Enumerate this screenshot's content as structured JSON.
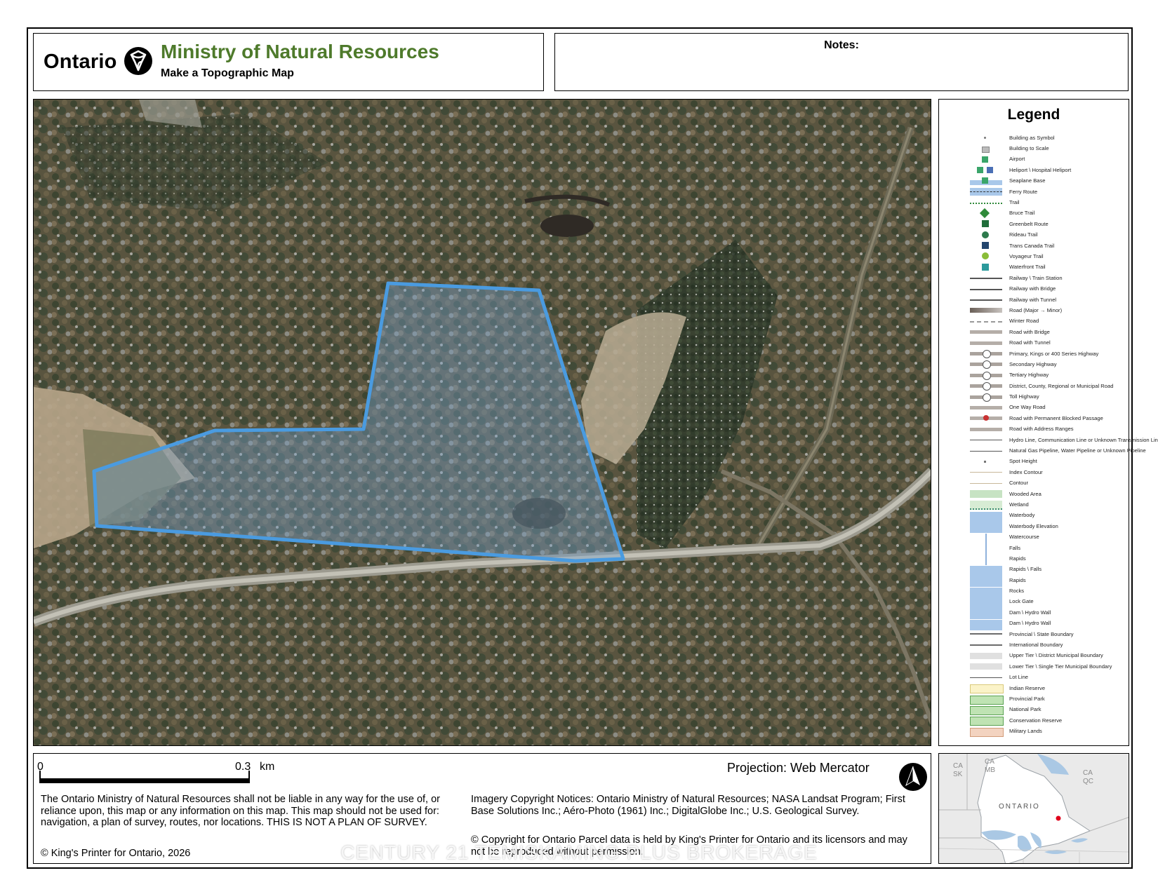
{
  "header": {
    "ontario_wordmark": "Ontario",
    "title": "Ministry of Natural Resources",
    "subtitle": "Make a Topographic Map",
    "notes_label": "Notes:",
    "title_color": "#4e7a2b"
  },
  "map": {
    "imagery": "aerial",
    "parcel_outline_color": "#4a9be0"
  },
  "legend": {
    "title": "Legend",
    "items": [
      {
        "label": "Building as Symbol",
        "symbol": "dot"
      },
      {
        "label": "Building to Scale",
        "symbol": "building"
      },
      {
        "label": "Airport",
        "symbol": "airport-icon"
      },
      {
        "label": "Heliport \\ Hospital Heliport",
        "symbol": "heliport-icon"
      },
      {
        "label": "Seaplane Base",
        "symbol": "seaplane-icon"
      },
      {
        "label": "Ferry Route",
        "symbol": "ferry-line"
      },
      {
        "label": "Trail",
        "symbol": "trail-line"
      },
      {
        "label": "Bruce Trail",
        "symbol": "bruce-trail-icon"
      },
      {
        "label": "Greenbelt Route",
        "symbol": "greenbelt-icon"
      },
      {
        "label": "Rideau Trail",
        "symbol": "rideau-icon"
      },
      {
        "label": "Trans Canada Trail",
        "symbol": "trans-canada-icon"
      },
      {
        "label": "Voyageur Trail",
        "symbol": "voyageur-icon"
      },
      {
        "label": "Waterfront Trail",
        "symbol": "waterfront-icon"
      },
      {
        "label": "Railway \\ Train Station",
        "symbol": "railway"
      },
      {
        "label": "Railway with Bridge",
        "symbol": "railway"
      },
      {
        "label": "Railway with Tunnel",
        "symbol": "railway"
      },
      {
        "label": "Road (Major → Minor)",
        "symbol": "road-taper"
      },
      {
        "label": "Winter Road",
        "symbol": "dashed-road"
      },
      {
        "label": "Road with Bridge",
        "symbol": "road"
      },
      {
        "label": "Road with Tunnel",
        "symbol": "road"
      },
      {
        "label": "Primary, Kings or 400 Series Highway",
        "symbol": "highway"
      },
      {
        "label": "Secondary Highway",
        "symbol": "highway"
      },
      {
        "label": "Tertiary Highway",
        "symbol": "highway"
      },
      {
        "label": "District, County, Regional or Municipal Road",
        "symbol": "highway"
      },
      {
        "label": "Toll Highway",
        "symbol": "highway"
      },
      {
        "label": "One Way Road",
        "symbol": "road"
      },
      {
        "label": "Road with Permanent Blocked Passage",
        "symbol": "blocked-road"
      },
      {
        "label": "Road with Address Ranges",
        "symbol": "road"
      },
      {
        "label": "Hydro Line, Communication Line or Unknown Transmission Line",
        "symbol": "thin-line"
      },
      {
        "label": "Natural Gas Pipeline, Water Pipeline or Unknown Pipeline",
        "symbol": "thin-line"
      },
      {
        "label": "Spot Height",
        "symbol": "spot"
      },
      {
        "label": "Index Contour",
        "symbol": "contour"
      },
      {
        "label": "Contour",
        "symbol": "contour"
      },
      {
        "label": "Wooded Area",
        "symbol": "wooded"
      },
      {
        "label": "Wetland",
        "symbol": "wetland"
      },
      {
        "label": "Waterbody",
        "symbol": "water"
      },
      {
        "label": "Waterbody Elevation",
        "symbol": "water"
      },
      {
        "label": "Watercourse",
        "symbol": "watercourse"
      },
      {
        "label": "Falls",
        "symbol": "watercourse"
      },
      {
        "label": "Rapids",
        "symbol": "watercourse"
      },
      {
        "label": "Rapids \\ Falls",
        "symbol": "water"
      },
      {
        "label": "Rapids",
        "symbol": "water"
      },
      {
        "label": "Rocks",
        "symbol": "water"
      },
      {
        "label": "Lock Gate",
        "symbol": "water"
      },
      {
        "label": "Dam \\ Hydro Wall",
        "symbol": "water"
      },
      {
        "label": "Dam \\ Hydro Wall",
        "symbol": "water"
      },
      {
        "label": "Provincial \\ State Boundary",
        "symbol": "boundary"
      },
      {
        "label": "International Boundary",
        "symbol": "boundary"
      },
      {
        "label": "Upper Tier \\ District Municipal Boundary",
        "symbol": "grey-band"
      },
      {
        "label": "Lower Tier \\ Single Tier Municipal Boundary",
        "symbol": "grey-band"
      },
      {
        "label": "Lot Line",
        "symbol": "thin-line"
      },
      {
        "label": "Indian Reserve",
        "symbol": "reserve"
      },
      {
        "label": "Provincial Park",
        "symbol": "park"
      },
      {
        "label": "National Park",
        "symbol": "park"
      },
      {
        "label": "Conservation Reserve",
        "symbol": "park"
      },
      {
        "label": "Military Lands",
        "symbol": "military"
      }
    ]
  },
  "footer": {
    "scale_start": "0",
    "scale_end": "0.3",
    "scale_unit": "km",
    "projection": "Projection: Web Mercator",
    "disclaimer": "The Ontario Ministry of Natural Resources shall not be liable in any way for the use of, or reliance upon, this map or any information on this map.  This map should not be used for: navigation, a plan of survey, routes, nor locations. THIS IS NOT A PLAN OF SURVEY.",
    "imagery_notice": "Imagery Copyright Notices: Ontario Ministry of Natural Resources; NASA Landsat Program; First Base Solutions Inc.; Aéro-Photo (1961) Inc.; DigitalGlobe Inc.; U.S. Geological Survey.",
    "parcel_copyright": "© Copyright for Ontario Parcel data is held by King's Printer for Ontario and its licensors and may not be reproduced without permission.",
    "kings_printer": "© King's Printer for Ontario,  2026"
  },
  "inset_map": {
    "labels": {
      "ca_sk": [
        "CA",
        "SK"
      ],
      "ca_mb": [
        "CA",
        "MB"
      ],
      "ca_qc": [
        "CA",
        "QC"
      ],
      "province": "ONTARIO"
    },
    "location_marker_color": "#e0001b"
  },
  "watermark": "CENTURY 21 TEMISKAMING PLUS BROKERAGE"
}
